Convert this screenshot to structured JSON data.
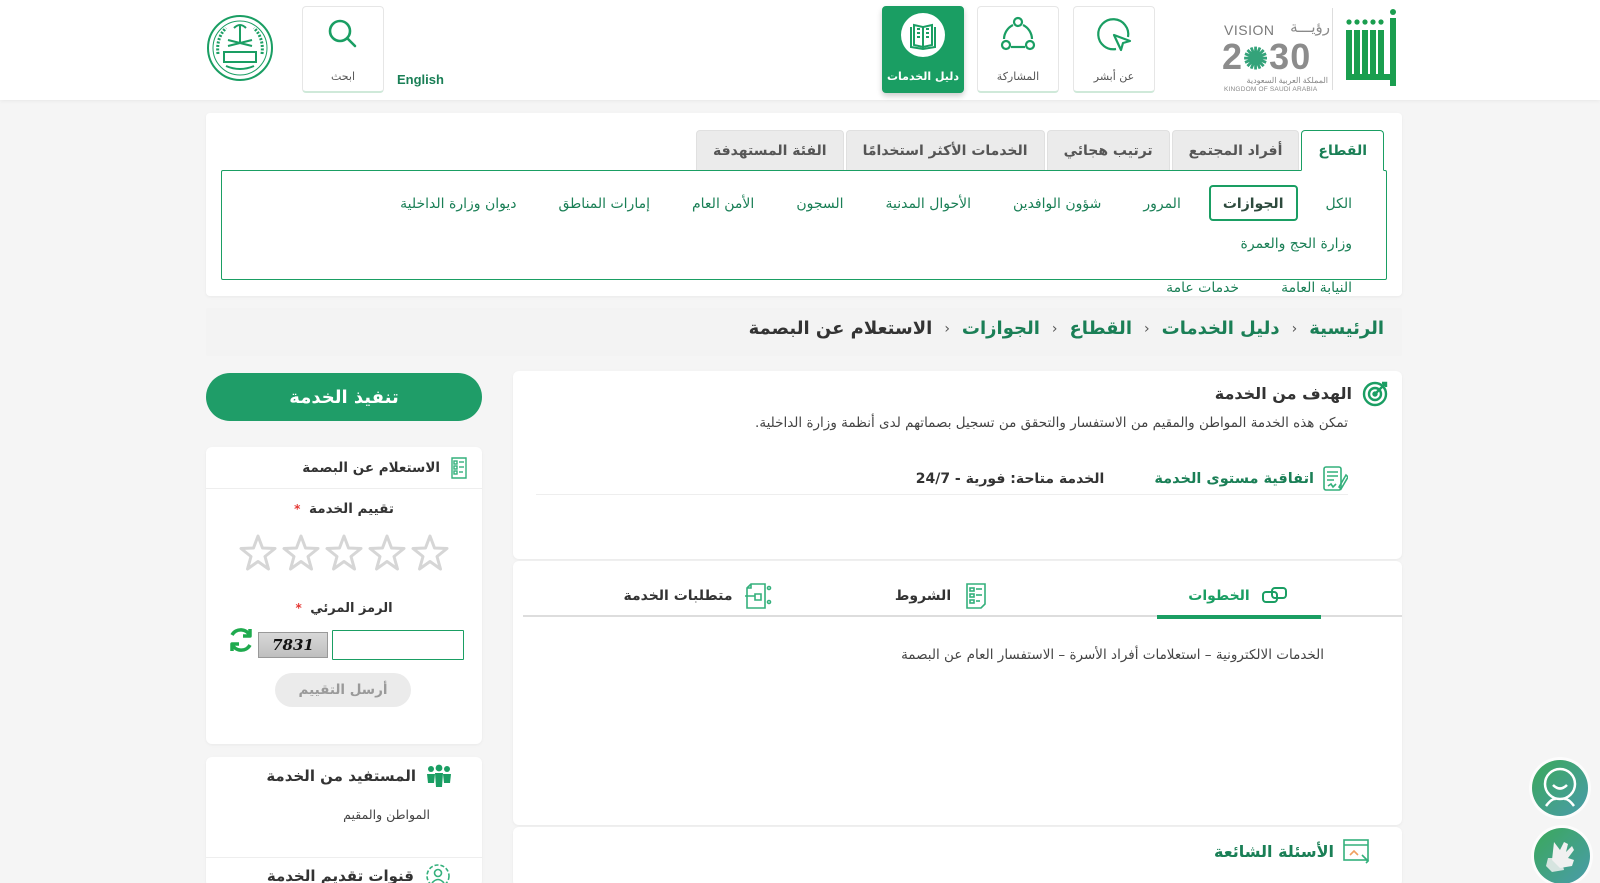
{
  "header": {
    "logos": {
      "absher": "absher-logo",
      "vision_word": "VISION",
      "vision_ar": "رؤيـــة",
      "vision_year": "2030",
      "vision_ksa_ar": "المملكة العربية السعودية",
      "vision_ksa_en": "KINGDOM OF SAUDI ARABIA",
      "emblem": "ministry-of-interior-emblem"
    },
    "nav": [
      {
        "label": "عن أبشر",
        "icon": "cursor-click-icon",
        "active": false
      },
      {
        "label": "المشاركة",
        "icon": "share-network-icon",
        "active": false
      },
      {
        "label": "دليل الخدمات",
        "icon": "book-icon",
        "active": true
      }
    ],
    "search_label": "ابحث",
    "language_link": "English"
  },
  "sector_panel": {
    "tabs": [
      {
        "label": "القطاع",
        "active": true
      },
      {
        "label": "أفراد المجتمع",
        "active": false
      },
      {
        "label": "ترتيب هجائي",
        "active": false
      },
      {
        "label": "الخدمات الأكثر استخدامًا",
        "active": false
      },
      {
        "label": "الفئة المستهدفة",
        "active": false
      }
    ],
    "sectors": [
      {
        "label": "الكل",
        "active": false
      },
      {
        "label": "الجوازات",
        "active": true
      },
      {
        "label": "المرور",
        "active": false
      },
      {
        "label": "شؤون الوافدين",
        "active": false
      },
      {
        "label": "الأحوال المدنية",
        "active": false
      },
      {
        "label": "السجون",
        "active": false
      },
      {
        "label": "الأمن العام",
        "active": false
      },
      {
        "label": "إمارات المناطق",
        "active": false
      },
      {
        "label": "ديوان وزارة الداخلية",
        "active": false
      },
      {
        "label": "وزارة الحج والعمرة",
        "active": false
      },
      {
        "label": "النيابة العامة",
        "active": false
      },
      {
        "label": "خدمات عامة",
        "active": false
      }
    ]
  },
  "breadcrumb": {
    "items": [
      "الرئيسية",
      "دليل الخدمات",
      "القطاع",
      "الجوازات"
    ],
    "current": "الاستعلام عن البصمة",
    "separator": "›"
  },
  "goal": {
    "title": "الهدف من الخدمة",
    "description": "تمكن هذه الخدمة المواطن والمقيم من الاستفسار والتحقق من تسجيل بصماتهم لدى أنظمة وزارة الداخلية.",
    "sla_title": "اتفاقية مستوى الخدمة",
    "sla_value": "الخدمة متاحة: فورية - 24/7"
  },
  "service_tabs": {
    "tabs": [
      {
        "label": "الخطوات",
        "icon": "steps-icon",
        "active": true
      },
      {
        "label": "الشروط",
        "icon": "checklist-icon",
        "active": false
      },
      {
        "label": "متطلبات الخدمة",
        "icon": "requirements-icon",
        "active": false
      }
    ],
    "steps_content": "الخدمات الالكترونية – استعلامات أفراد الأسرة – الاستفسار العام عن البصمة"
  },
  "faq": {
    "title": "الأسئلة الشائعة"
  },
  "sidebar": {
    "execute_button": "تنفيذ الخدمة",
    "rating": {
      "service_name": "الاستعلام عن البصمة",
      "rate_label": "تقييم الخدمة",
      "required_mark": "*",
      "stars_total": 5,
      "stars_selected": 0,
      "code_label": "الرمز المرئي",
      "captcha_text": "7831",
      "captcha_input_value": "",
      "send_button": "أرسل التقييم"
    },
    "beneficiary": {
      "title": "المستفيد من الخدمة",
      "value": "المواطن والمقيم"
    },
    "channels": {
      "title": "قنوات تقديم الخدمة"
    }
  },
  "floating": {
    "support": "support-chat-icon",
    "sign_language": "sign-language-icon"
  },
  "colors": {
    "brand_green": "#1a9e63",
    "link_green": "#1a7f56",
    "required_red": "#e53935"
  }
}
